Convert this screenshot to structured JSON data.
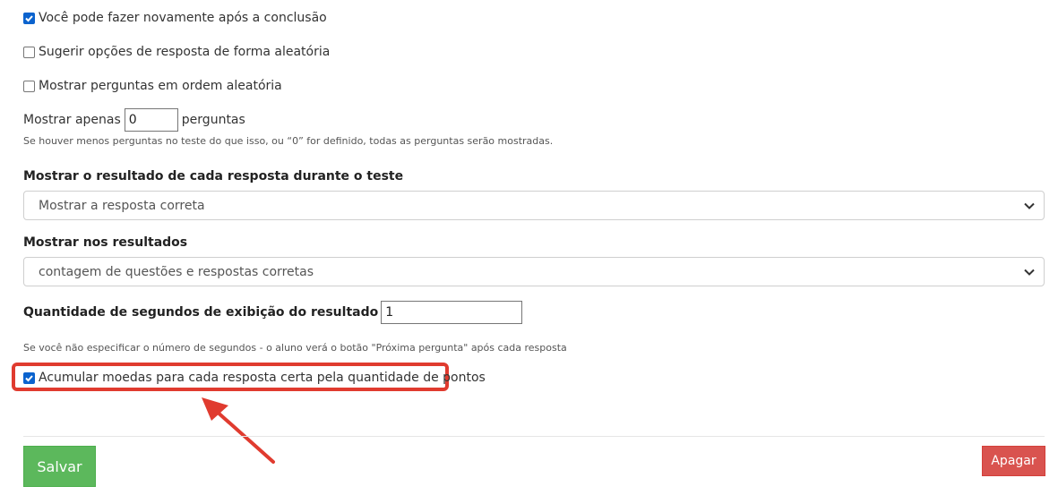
{
  "options": {
    "retry": {
      "label": "Você pode fazer novamente após a conclusão",
      "checked": true
    },
    "shuffle_answers": {
      "label": "Sugerir opções de resposta de forma aleatória",
      "checked": false
    },
    "shuffle_questions": {
      "label": "Mostrar perguntas em ordem aleatória",
      "checked": false
    },
    "accumulate_coins": {
      "label": "Acumular moedas para cada resposta certa pela quantidade de pontos",
      "checked": true
    }
  },
  "show_only": {
    "prefix": "Mostrar apenas",
    "value": "0",
    "suffix": "perguntas",
    "help": "Se houver menos perguntas no teste do que isso, ou “0” for definido, todas as perguntas serão mostradas."
  },
  "result_each_answer": {
    "heading": "Mostrar o resultado de cada resposta durante o teste",
    "selected": "Mostrar a resposta correta"
  },
  "show_in_results": {
    "heading": "Mostrar nos resultados",
    "selected": "contagem de questões e respostas corretas"
  },
  "seconds": {
    "label": "Quantidade de segundos de exibição do resultado",
    "value": "1",
    "help": "Se você não especificar o número de segundos - o aluno verá o botão \"Próxima pergunta\" após cada resposta"
  },
  "buttons": {
    "save": "Salvar",
    "delete": "Apagar"
  },
  "colors": {
    "save": "#5cb85c",
    "delete": "#d9534f",
    "highlight": "#e03b2f",
    "checkbox": "#0b63ce"
  },
  "icons": {
    "select_caret": "chevron-down-icon",
    "annotation": "arrow-icon"
  }
}
